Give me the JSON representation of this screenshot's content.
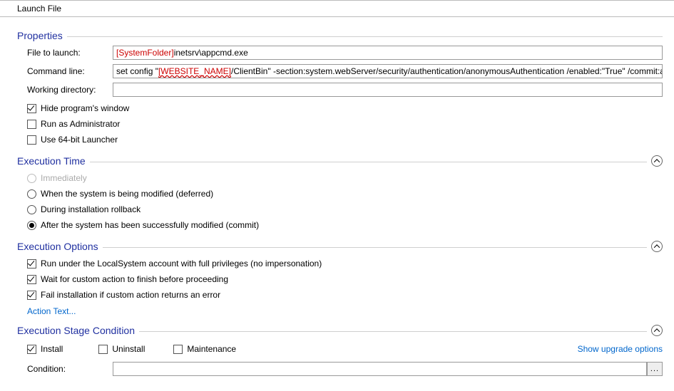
{
  "header": {
    "title": "Launch File"
  },
  "properties": {
    "title": "Properties",
    "file_label": "File to launch:",
    "file_token": "[SystemFolder]",
    "file_rest": "inetsrv\\appcmd.exe",
    "cmd_label": "Command line:",
    "cmd_pre": "set config \"",
    "cmd_token": "[WEBSITE_NAME]",
    "cmd_post": "/ClientBin\" -section:system.webServer/security/authentication/anonymousAuthentication /enabled:\"True\" /commit:apphost",
    "wd_label": "Working directory:",
    "wd_value": "",
    "hide_label": "Hide program's window",
    "admin_label": "Run as Administrator",
    "x64_label": "Use 64-bit Launcher"
  },
  "exec_time": {
    "title": "Execution Time",
    "immediate": "Immediately",
    "deferred": "When the system is being modified (deferred)",
    "rollback": "During installation rollback",
    "commit": "After the system has been successfully modified (commit)"
  },
  "exec_opts": {
    "title": "Execution Options",
    "localsystem": "Run under the LocalSystem account with full privileges (no impersonation)",
    "wait": "Wait for custom action to finish before proceeding",
    "fail": "Fail installation if custom action returns an error",
    "action_text": "Action Text..."
  },
  "stage": {
    "title": "Execution Stage Condition",
    "install": "Install",
    "uninstall": "Uninstall",
    "maintenance": "Maintenance",
    "upgrade_link": "Show upgrade options",
    "condition_label": "Condition:",
    "condition_value": "",
    "ellipsis": "..."
  }
}
